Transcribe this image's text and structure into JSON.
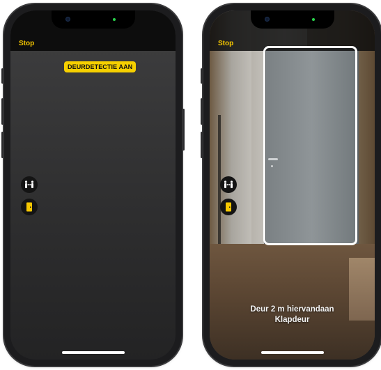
{
  "left_screen": {
    "stop_label": "Stop",
    "mode_badge": "DEURDETECTIE AAN"
  },
  "right_screen": {
    "stop_label": "Stop",
    "detection_distance": "Deur 2 m hiervandaan",
    "detection_type": "Klapdeur"
  },
  "icons": {
    "people_detection": "people-detection-icon",
    "door_detection": "door-detection-icon"
  },
  "colors": {
    "accent": "#f6c700",
    "badge": "#f6d000",
    "detection_box": "#ffffff"
  }
}
